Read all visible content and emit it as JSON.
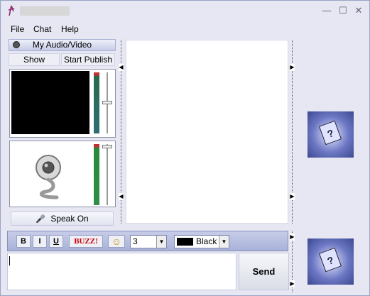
{
  "icons": {
    "app": "app-icon",
    "minimize": "minimize-icon",
    "maximize": "maximize-icon",
    "close": "close-icon",
    "speaker": "speaker-icon",
    "microphone": "microphone-icon",
    "webcam": "webcam-image",
    "smiley": "smiley-icon",
    "help": "help-cube-image"
  },
  "window": {
    "minimize_glyph": "—",
    "maximize_glyph": "☐",
    "close_glyph": "✕"
  },
  "menu": {
    "file": "File",
    "chat": "Chat",
    "help": "Help"
  },
  "av_panel": {
    "title": "My Audio/Video",
    "show_button": "Show",
    "publish_button": "Start Publish",
    "speak_button": "Speak On"
  },
  "toolbar": {
    "bold": "B",
    "italic": "I",
    "underline": "U",
    "buzz": "BUZZ!",
    "smiley_glyph": "☺",
    "font_size": "3",
    "color_name": "Black",
    "color_value": "#000000",
    "dropdown_glyph": "▼"
  },
  "send": {
    "label": "Send"
  },
  "help_image_glyph": "?",
  "colors": {
    "window_bg": "#e6e7f2",
    "toolbar_bg": "#b5bde0",
    "buzz_text": "#cc0000"
  }
}
